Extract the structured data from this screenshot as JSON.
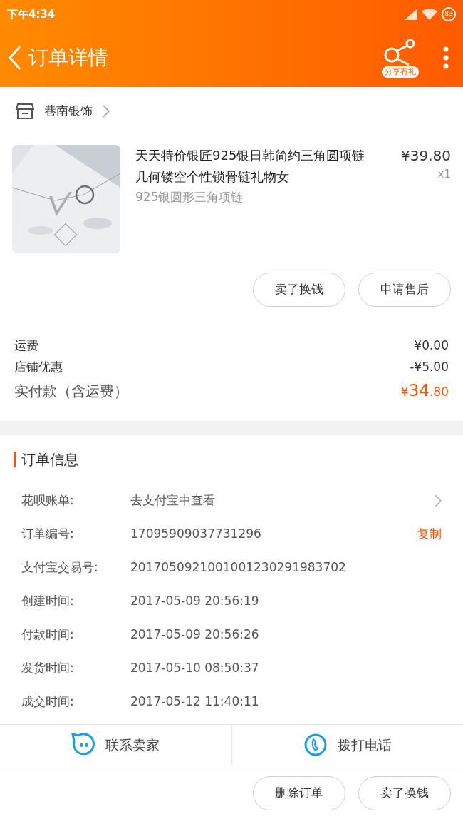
{
  "status_bar": {
    "time": "下午4:34",
    "battery": "83"
  },
  "header": {
    "title": "订单详情",
    "share_label": "分享有礼"
  },
  "store": {
    "name": "巷南银饰"
  },
  "product": {
    "title": "天天特价银匠925银日韩简约三角圆项链几何镂空个性锁骨链礼物女",
    "sku": "925银圆形三角项链",
    "price": "¥39.80",
    "quantity": "x1"
  },
  "item_actions": [
    "卖了换钱",
    "申请售后"
  ],
  "fees": [
    {
      "label": "运费",
      "value": "¥0.00"
    },
    {
      "label": "店铺优惠",
      "value": "-¥5.00"
    }
  ],
  "total": {
    "label": "实付款（含运费）",
    "currency": "¥",
    "integer": "34",
    "decimal": ".80"
  },
  "order_info": {
    "title": "订单信息",
    "rows": [
      {
        "kind": "link",
        "label": "花呗账单:",
        "value": "去支付宝中查看"
      },
      {
        "kind": "copy",
        "label": "订单编号:",
        "value": "17095909037731296",
        "action": "复制"
      },
      {
        "kind": "plain",
        "label": "支付宝交易号:",
        "value": "2017050921001001230291983702"
      },
      {
        "kind": "plain",
        "label": "创建时间:",
        "value": "2017-05-09 20:56:19"
      },
      {
        "kind": "plain",
        "label": "付款时间:",
        "value": "2017-05-09 20:56:26"
      },
      {
        "kind": "plain",
        "label": "发货时间:",
        "value": "2017-05-10 08:50:37"
      },
      {
        "kind": "plain",
        "label": "成交时间:",
        "value": "2017-05-12 11:40:11"
      }
    ]
  },
  "contact": [
    {
      "kind": "chat",
      "label": "联系卖家"
    },
    {
      "kind": "phone",
      "label": "拨打电话"
    }
  ],
  "bottom_actions": [
    "删除订单",
    "卖了换钱"
  ]
}
